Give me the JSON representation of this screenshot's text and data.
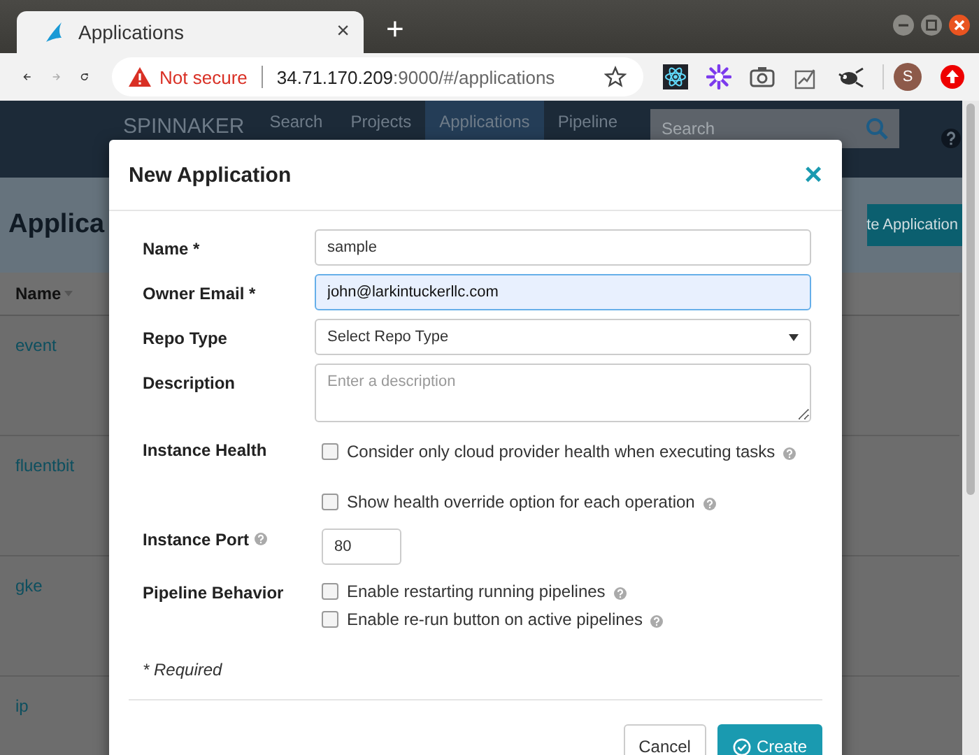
{
  "browser": {
    "tab_title": "Applications",
    "tab_close": "×",
    "new_tab": "+",
    "security_label": "Not secure",
    "url_host": "34.71.170.209",
    "url_rest": ":9000/#/applications",
    "profile_initial": "S"
  },
  "app": {
    "brand": "SPINNAKER",
    "nav": [
      {
        "label": "Search",
        "selected": false
      },
      {
        "label": "Projects",
        "selected": false
      },
      {
        "label": "Applications",
        "selected": true
      },
      {
        "label": "Pipeline",
        "selected": false
      }
    ],
    "search_placeholder": "Search",
    "heading": "Applica",
    "create_button": "te Application",
    "table": {
      "columns": [
        "Name"
      ],
      "rows": [
        "event",
        "fluentbit",
        "gke",
        "ip"
      ]
    }
  },
  "dialog": {
    "title": "New Application",
    "close": "×",
    "fields": [
      {
        "kind": "text",
        "label": "Name *",
        "value": "sample",
        "focused": false
      },
      {
        "kind": "text",
        "label": "Owner Email *",
        "value": "john@larkintuckerllc.com",
        "focused": true
      },
      {
        "kind": "select",
        "label": "Repo Type",
        "value": "Select Repo Type"
      },
      {
        "kind": "textarea",
        "label": "Description",
        "placeholder": "Enter a description"
      },
      {
        "kind": "checkboxes",
        "label": "Instance Health",
        "spaced": true,
        "options": [
          {
            "label": "Consider only cloud provider health when executing tasks",
            "checked": false,
            "help": true
          },
          {
            "label": "Show health override option for each operation",
            "checked": false,
            "help": true
          }
        ]
      },
      {
        "kind": "number",
        "label": "Instance Port",
        "help": true,
        "value": "80"
      },
      {
        "kind": "checkboxes",
        "label": "Pipeline Behavior",
        "spaced": false,
        "options": [
          {
            "label": "Enable restarting running pipelines",
            "checked": false,
            "help": true
          },
          {
            "label": "Enable re-run button on active pipelines",
            "checked": false,
            "help": true
          }
        ]
      }
    ],
    "required_note": "* Required",
    "buttons": [
      {
        "label": "Cancel",
        "kind": "secondary"
      },
      {
        "label": "Create",
        "kind": "primary"
      }
    ]
  }
}
